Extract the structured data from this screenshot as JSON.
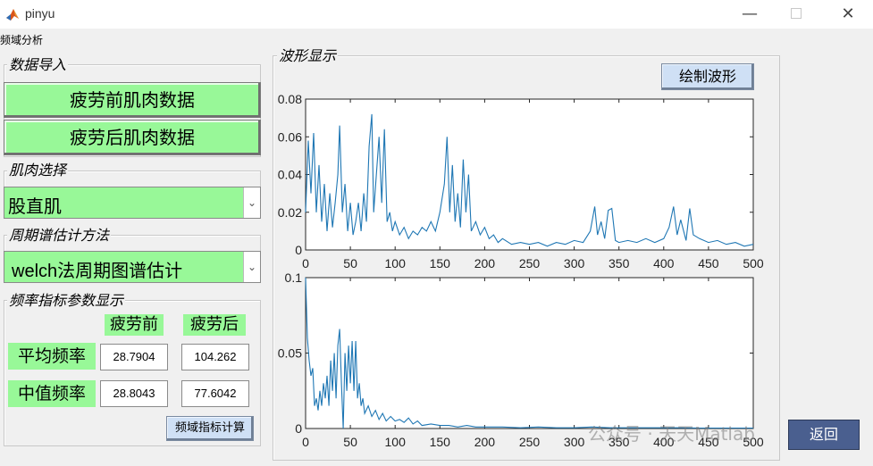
{
  "window": {
    "title": "pinyu",
    "minimize_icon": "minimize-icon",
    "maximize_icon": "maximize-icon",
    "close_icon": "close-icon"
  },
  "menu": {
    "item": "频域分析"
  },
  "data_import": {
    "legend": "数据导入",
    "before_button": "疲劳前肌肉数据",
    "after_button": "疲劳后肌肉数据"
  },
  "muscle_select": {
    "legend": "肌肉选择",
    "selected": "股直肌"
  },
  "method_select": {
    "legend": "周期谱估计方法",
    "selected": "welch法周期图谱估计"
  },
  "freq_params": {
    "legend": "频率指标参数显示",
    "col_before": "疲劳前",
    "col_after": "疲劳后",
    "row_mean": "平均频率",
    "row_median": "中值频率",
    "mean_before": "28.7904",
    "mean_after": "104.262",
    "median_before": "28.8043",
    "median_after": "77.6042",
    "calc_button": "频域指标计算"
  },
  "waveform": {
    "legend": "波形显示",
    "draw_button": "绘制波形"
  },
  "return_button": "返回",
  "watermark": "公众号 · 天天Matlab",
  "colors": {
    "green": "#98f898",
    "line": "#1f77b4",
    "button_blue": "#cfe0f5",
    "return_bg": "#4a5f8f"
  },
  "chart_data": [
    {
      "type": "line",
      "xlim": [
        0,
        500
      ],
      "ylim": [
        0,
        0.08
      ],
      "xticks": [
        0,
        50,
        100,
        150,
        200,
        250,
        300,
        350,
        400,
        450,
        500
      ],
      "yticks": [
        "0",
        "0.02",
        "0.04",
        "0.06",
        "0.08"
      ],
      "ytick_values": [
        0,
        0.02,
        0.04,
        0.06,
        0.08
      ],
      "points": [
        [
          0,
          0.02
        ],
        [
          3,
          0.058
        ],
        [
          6,
          0.03
        ],
        [
          9,
          0.062
        ],
        [
          12,
          0.02
        ],
        [
          15,
          0.045
        ],
        [
          18,
          0.015
        ],
        [
          21,
          0.035
        ],
        [
          24,
          0.01
        ],
        [
          27,
          0.03
        ],
        [
          30,
          0.012
        ],
        [
          33,
          0.025
        ],
        [
          36,
          0.04
        ],
        [
          38,
          0.066
        ],
        [
          41,
          0.02
        ],
        [
          44,
          0.035
        ],
        [
          47,
          0.01
        ],
        [
          50,
          0.025
        ],
        [
          53,
          0.008
        ],
        [
          56,
          0.015
        ],
        [
          59,
          0.025
        ],
        [
          62,
          0.01
        ],
        [
          65,
          0.03
        ],
        [
          68,
          0.015
        ],
        [
          71,
          0.055
        ],
        [
          74,
          0.072
        ],
        [
          76,
          0.02
        ],
        [
          79,
          0.04
        ],
        [
          82,
          0.06
        ],
        [
          85,
          0.025
        ],
        [
          88,
          0.064
        ],
        [
          91,
          0.015
        ],
        [
          94,
          0.02
        ],
        [
          97,
          0.01
        ],
        [
          100,
          0.015
        ],
        [
          105,
          0.008
        ],
        [
          110,
          0.012
        ],
        [
          115,
          0.006
        ],
        [
          120,
          0.01
        ],
        [
          125,
          0.008
        ],
        [
          130,
          0.012
        ],
        [
          135,
          0.01
        ],
        [
          140,
          0.015
        ],
        [
          145,
          0.01
        ],
        [
          150,
          0.02
        ],
        [
          155,
          0.035
        ],
        [
          158,
          0.06
        ],
        [
          161,
          0.02
        ],
        [
          164,
          0.045
        ],
        [
          167,
          0.015
        ],
        [
          170,
          0.03
        ],
        [
          173,
          0.012
        ],
        [
          176,
          0.048
        ],
        [
          179,
          0.02
        ],
        [
          182,
          0.04
        ],
        [
          185,
          0.01
        ],
        [
          190,
          0.015
        ],
        [
          195,
          0.008
        ],
        [
          200,
          0.012
        ],
        [
          205,
          0.006
        ],
        [
          210,
          0.008
        ],
        [
          215,
          0.004
        ],
        [
          220,
          0.006
        ],
        [
          230,
          0.003
        ],
        [
          240,
          0.004
        ],
        [
          250,
          0.003
        ],
        [
          260,
          0.004
        ],
        [
          270,
          0.002
        ],
        [
          280,
          0.004
        ],
        [
          290,
          0.003
        ],
        [
          300,
          0.005
        ],
        [
          310,
          0.004
        ],
        [
          318,
          0.01
        ],
        [
          323,
          0.023
        ],
        [
          326,
          0.008
        ],
        [
          330,
          0.015
        ],
        [
          334,
          0.006
        ],
        [
          338,
          0.021
        ],
        [
          342,
          0.022
        ],
        [
          346,
          0.005
        ],
        [
          350,
          0.004
        ],
        [
          360,
          0.005
        ],
        [
          370,
          0.004
        ],
        [
          380,
          0.006
        ],
        [
          390,
          0.004
        ],
        [
          400,
          0.006
        ],
        [
          406,
          0.012
        ],
        [
          411,
          0.023
        ],
        [
          415,
          0.008
        ],
        [
          419,
          0.016
        ],
        [
          425,
          0.005
        ],
        [
          429,
          0.022
        ],
        [
          433,
          0.008
        ],
        [
          440,
          0.006
        ],
        [
          450,
          0.004
        ],
        [
          460,
          0.005
        ],
        [
          470,
          0.003
        ],
        [
          480,
          0.004
        ],
        [
          490,
          0.002
        ],
        [
          500,
          0.003
        ]
      ]
    },
    {
      "type": "line",
      "xlim": [
        0,
        500
      ],
      "ylim": [
        0,
        0.1
      ],
      "xticks": [
        0,
        50,
        100,
        150,
        200,
        250,
        300,
        350,
        400,
        450,
        500
      ],
      "yticks": [
        "0",
        "0.05",
        "0.1"
      ],
      "ytick_values": [
        0,
        0.05,
        0.1
      ],
      "points": [
        [
          0,
          0.1
        ],
        [
          2,
          0.06
        ],
        [
          4,
          0.045
        ],
        [
          6,
          0.035
        ],
        [
          8,
          0.04
        ],
        [
          10,
          0.015
        ],
        [
          12,
          0.02
        ],
        [
          14,
          0.012
        ],
        [
          16,
          0.025
        ],
        [
          18,
          0.015
        ],
        [
          20,
          0.03
        ],
        [
          22,
          0.02
        ],
        [
          24,
          0.035
        ],
        [
          26,
          0.015
        ],
        [
          28,
          0.045
        ],
        [
          30,
          0.025
        ],
        [
          32,
          0.05
        ],
        [
          34,
          0.02
        ],
        [
          36,
          0.055
        ],
        [
          38,
          0.066
        ],
        [
          40,
          0.03
        ],
        [
          42,
          0.0
        ],
        [
          44,
          0.05
        ],
        [
          46,
          0.025
        ],
        [
          48,
          0.055
        ],
        [
          50,
          0.03
        ],
        [
          52,
          0.058
        ],
        [
          54,
          0.025
        ],
        [
          56,
          0.058
        ],
        [
          58,
          0.02
        ],
        [
          60,
          0.03
        ],
        [
          62,
          0.015
        ],
        [
          64,
          0.02
        ],
        [
          66,
          0.01
        ],
        [
          70,
          0.015
        ],
        [
          74,
          0.008
        ],
        [
          78,
          0.012
        ],
        [
          82,
          0.006
        ],
        [
          86,
          0.01
        ],
        [
          90,
          0.005
        ],
        [
          95,
          0.008
        ],
        [
          100,
          0.005
        ],
        [
          105,
          0.006
        ],
        [
          110,
          0.004
        ],
        [
          115,
          0.007
        ],
        [
          120,
          0.003
        ],
        [
          125,
          0.005
        ],
        [
          130,
          0.002
        ],
        [
          140,
          0.003
        ],
        [
          150,
          0.002
        ],
        [
          160,
          0.002
        ],
        [
          170,
          0.001
        ],
        [
          180,
          0.002
        ],
        [
          190,
          0.001
        ],
        [
          200,
          0.001
        ],
        [
          220,
          0.001
        ],
        [
          240,
          0.0005
        ],
        [
          260,
          0.001
        ],
        [
          280,
          0.0005
        ],
        [
          300,
          0.0005
        ],
        [
          320,
          0.001
        ],
        [
          340,
          0.0005
        ],
        [
          360,
          0.0005
        ],
        [
          380,
          0.0005
        ],
        [
          400,
          0.0005
        ],
        [
          420,
          0.0005
        ],
        [
          440,
          0.0003
        ],
        [
          460,
          0.0003
        ],
        [
          480,
          0.0003
        ],
        [
          500,
          0.0003
        ]
      ]
    }
  ]
}
